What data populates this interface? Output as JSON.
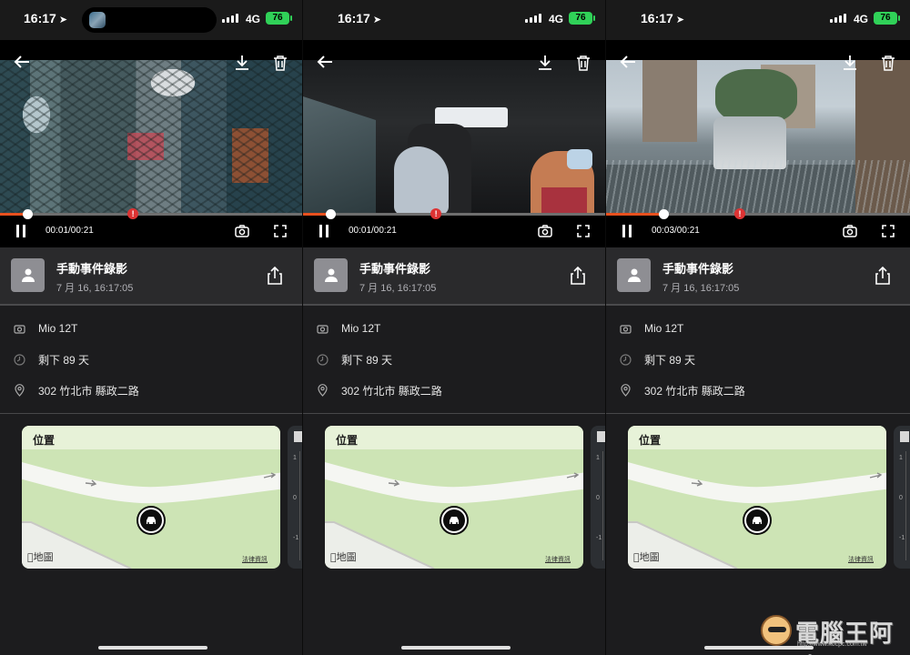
{
  "screens": [
    {
      "status": {
        "time": "16:17",
        "network": "4G",
        "battery": "76"
      },
      "video": {
        "timecode": "00:01/00:21",
        "progress": 0.09
      },
      "event": {
        "title": "手動事件錄影",
        "datetime": "7 月 16, 16:17:05"
      },
      "details": {
        "device": "Mio 12T",
        "remaining": "剩下 89 天",
        "address": "302 竹北市 縣政二路"
      },
      "map": {
        "title": "位置",
        "logo": "地圖",
        "legal": "法律資訊"
      }
    },
    {
      "status": {
        "time": "16:17",
        "network": "4G",
        "battery": "76"
      },
      "video": {
        "timecode": "00:01/00:21",
        "progress": 0.09
      },
      "event": {
        "title": "手動事件錄影",
        "datetime": "7 月 16, 16:17:05"
      },
      "details": {
        "device": "Mio 12T",
        "remaining": "剩下 89 天",
        "address": "302 竹北市 縣政二路"
      },
      "map": {
        "title": "位置",
        "logo": "地圖",
        "legal": "法律資訊"
      }
    },
    {
      "status": {
        "time": "16:17",
        "network": "4G",
        "battery": "76"
      },
      "video": {
        "timecode": "00:03/00:21",
        "progress": 0.19
      },
      "event": {
        "title": "手動事件錄影",
        "datetime": "7 月 16, 16:17:05"
      },
      "details": {
        "device": "Mio 12T",
        "remaining": "剩下 89 天",
        "address": "302 竹北市 縣政二路"
      },
      "map": {
        "title": "位置",
        "logo": "地圖",
        "legal": "法律資訊"
      }
    }
  ],
  "event_marker_position": 0.44,
  "side_chart_ticks": [
    "1",
    "0",
    "-1"
  ],
  "watermark": {
    "text": "電腦王阿達",
    "url": "http://www.kocpc.com.tw"
  },
  "colors": {
    "accent": "#e8501e",
    "battery": "#30d158",
    "event_marker": "#dd3333"
  },
  "icons": [
    "location-arrow-icon",
    "back-arrow-icon",
    "download-icon",
    "trash-icon",
    "pause-icon",
    "camera-icon",
    "fullscreen-icon",
    "person-icon",
    "share-icon",
    "dashcam-icon",
    "clock-icon",
    "location-pin-icon",
    "car-icon",
    "apple-icon"
  ]
}
